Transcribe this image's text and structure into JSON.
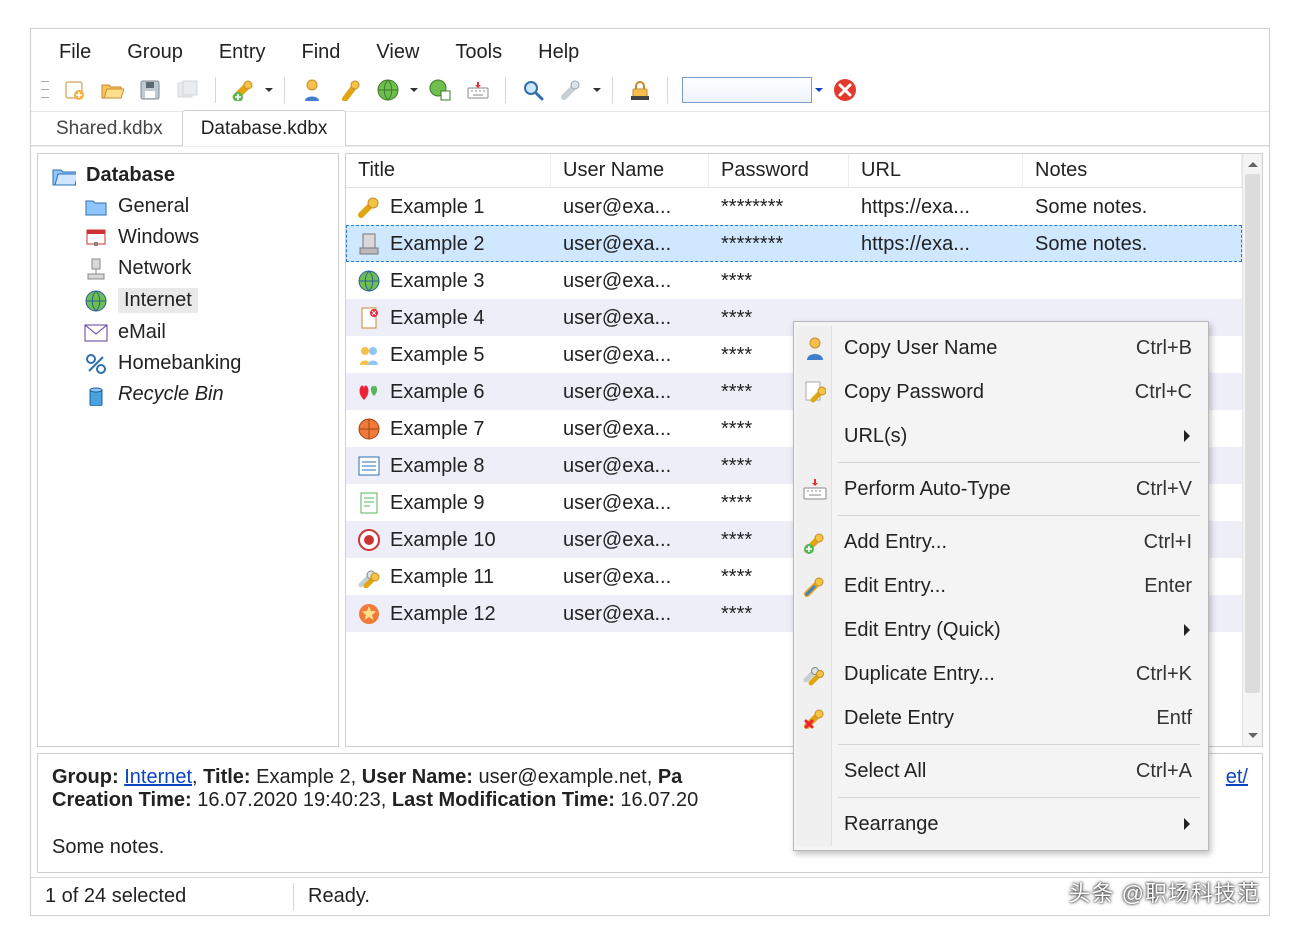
{
  "menubar": [
    "File",
    "Group",
    "Entry",
    "Find",
    "View",
    "Tools",
    "Help"
  ],
  "tabs": [
    {
      "label": "Shared.kdbx",
      "active": false
    },
    {
      "label": "Database.kdbx",
      "active": true
    }
  ],
  "sidebar": {
    "root": "Database",
    "items": [
      {
        "label": "General",
        "icon": "folder"
      },
      {
        "label": "Windows",
        "icon": "windows"
      },
      {
        "label": "Network",
        "icon": "network"
      },
      {
        "label": "Internet",
        "icon": "globe",
        "selected": true
      },
      {
        "label": "eMail",
        "icon": "mail"
      },
      {
        "label": "Homebanking",
        "icon": "percent"
      },
      {
        "label": "Recycle Bin",
        "icon": "bin",
        "italic": true
      }
    ]
  },
  "columns": [
    "Title",
    "User Name",
    "Password",
    "URL",
    "Notes"
  ],
  "entries": [
    {
      "title": "Example 1",
      "user": "user@exa...",
      "pass": "********",
      "url": "https://exa...",
      "notes": "Some notes.",
      "icon": "key"
    },
    {
      "title": "Example 2",
      "user": "user@exa...",
      "pass": "********",
      "url": "https://exa...",
      "notes": "Some notes.",
      "icon": "server",
      "selected": true
    },
    {
      "title": "Example 3",
      "user": "user@exa...",
      "pass": "****",
      "url": "",
      "notes": "",
      "icon": "globe"
    },
    {
      "title": "Example 4",
      "user": "user@exa...",
      "pass": "****",
      "url": "",
      "notes": "",
      "icon": "doc"
    },
    {
      "title": "Example 5",
      "user": "user@exa...",
      "pass": "****",
      "url": "",
      "notes": "",
      "icon": "people"
    },
    {
      "title": "Example 6",
      "user": "user@exa...",
      "pass": "****",
      "url": "",
      "notes": "",
      "icon": "hearts"
    },
    {
      "title": "Example 7",
      "user": "user@exa...",
      "pass": "****",
      "url": "",
      "notes": "",
      "icon": "ball"
    },
    {
      "title": "Example 8",
      "user": "user@exa...",
      "pass": "****",
      "url": "",
      "notes": "",
      "icon": "list"
    },
    {
      "title": "Example 9",
      "user": "user@exa...",
      "pass": "****",
      "url": "",
      "notes": "",
      "icon": "note"
    },
    {
      "title": "Example 10",
      "user": "user@exa...",
      "pass": "****",
      "url": "",
      "notes": "",
      "icon": "target"
    },
    {
      "title": "Example 11",
      "user": "user@exa...",
      "pass": "****",
      "url": "",
      "notes": "",
      "icon": "keys"
    },
    {
      "title": "Example 12",
      "user": "user@exa...",
      "pass": "****",
      "url": "",
      "notes": "",
      "icon": "star"
    }
  ],
  "context_menu": [
    {
      "label": "Copy User Name",
      "shortcut": "Ctrl+B",
      "icon": "person"
    },
    {
      "label": "Copy Password",
      "shortcut": "Ctrl+C",
      "icon": "keyv"
    },
    {
      "label": "URL(s)",
      "submenu": true
    },
    {
      "sep": true
    },
    {
      "label": "Perform Auto-Type",
      "shortcut": "Ctrl+V",
      "icon": "keyboard"
    },
    {
      "sep": true
    },
    {
      "label": "Add Entry...",
      "shortcut": "Ctrl+I",
      "icon": "keyadd"
    },
    {
      "label": "Edit Entry...",
      "shortcut": "Enter",
      "icon": "keyedit"
    },
    {
      "label": "Edit Entry (Quick)",
      "submenu": true
    },
    {
      "label": "Duplicate Entry...",
      "shortcut": "Ctrl+K",
      "icon": "keydup"
    },
    {
      "label": "Delete Entry",
      "shortcut": "Entf",
      "icon": "keydel"
    },
    {
      "sep": true
    },
    {
      "label": "Select All",
      "shortcut": "Ctrl+A"
    },
    {
      "sep": true
    },
    {
      "label": "Rearrange",
      "submenu": true
    }
  ],
  "detail": {
    "group_label": "Group:",
    "group": "Internet",
    "title_label": "Title:",
    "title": "Example 2",
    "user_label": "User Name:",
    "user": "user@example.net",
    "pa": "Pa",
    "suffix_link": "et/",
    "creation_label": "Creation Time:",
    "creation": "16.07.2020 19:40:23",
    "mod_label": "Last Modification Time:",
    "mod": "16.07.20",
    "notes": "Some notes."
  },
  "status": {
    "selection": "1 of 24 selected",
    "ready": "Ready."
  },
  "watermark": "头条 @职场科技范"
}
